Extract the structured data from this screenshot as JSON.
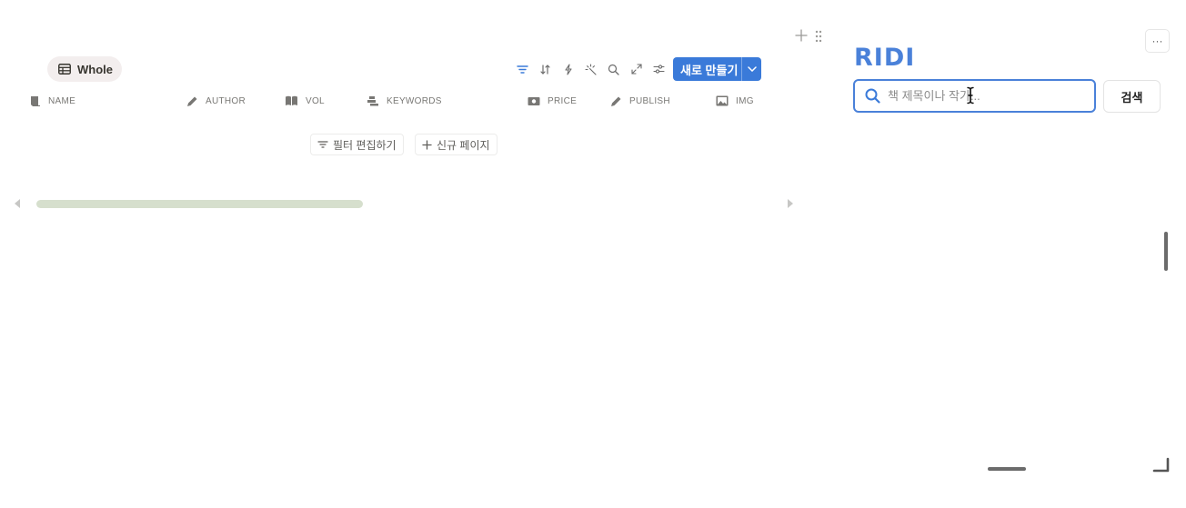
{
  "database": {
    "view_tab": {
      "label": "Whole",
      "icon": "table-icon"
    },
    "toolbar": {
      "icons": [
        "filter-icon",
        "sort-icon",
        "automation-icon",
        "ai-icon",
        "search-icon",
        "expand-icon",
        "settings-icon"
      ],
      "active_color": "#3a7ad9",
      "new_button_label": "새로 만들기"
    },
    "columns": [
      {
        "label": "NAME",
        "icon": "book-icon"
      },
      {
        "label": "AUTHOR",
        "icon": "pen-icon"
      },
      {
        "label": "VOL",
        "icon": "open-book-icon"
      },
      {
        "label": "KEYWORDS",
        "icon": "stack-icon"
      },
      {
        "label": "PRICE",
        "icon": "money-icon"
      },
      {
        "label": "PUBLISH",
        "icon": "pen-icon"
      },
      {
        "label": "IMG",
        "icon": "image-icon"
      }
    ],
    "actions": {
      "edit_filter": "필터 편집하기",
      "new_page": "신규 페이지"
    }
  },
  "embed": {
    "brand": "RIDI",
    "search": {
      "placeholder": "책 제목이나 작가...",
      "value": ""
    },
    "search_button": "검색",
    "more_label": "···",
    "brand_color": "#4a81d9"
  }
}
